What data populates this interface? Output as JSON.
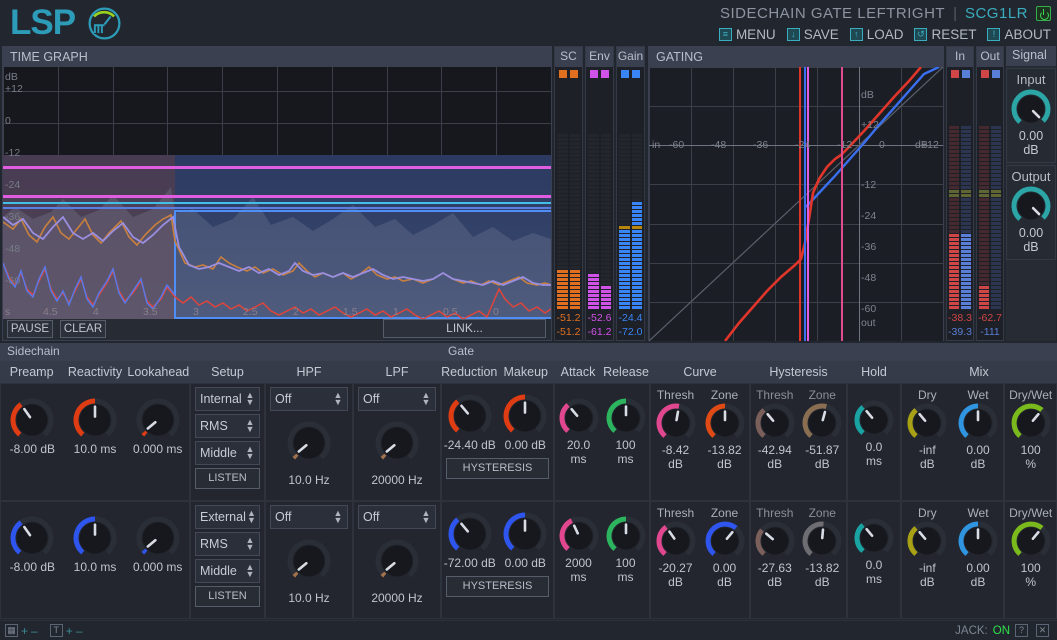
{
  "header": {
    "logo_text": "LSP",
    "plugin_title": "SIDECHAIN GATE LEFTRIGHT",
    "separator": "|",
    "plugin_id": "SCG1LR",
    "power_icon": "power-icon",
    "menu": [
      {
        "label": "MENU",
        "icon": "hamburger-icon",
        "glyph": "≡"
      },
      {
        "label": "SAVE",
        "icon": "download-icon",
        "glyph": "↓"
      },
      {
        "label": "LOAD",
        "icon": "upload-icon",
        "glyph": "↑"
      },
      {
        "label": "RESET",
        "icon": "refresh-icon",
        "glyph": "↺"
      },
      {
        "label": "ABOUT",
        "icon": "info-icon",
        "glyph": "!"
      }
    ]
  },
  "time_graph": {
    "title": "TIME GRAPH",
    "y_unit": "dB",
    "y_ticks": [
      "+12",
      "0",
      "-12",
      "-24",
      "-36",
      "-48",
      "-60"
    ],
    "x_unit": "s",
    "x_ticks": [
      "4.5",
      "4",
      "3.5",
      "3",
      "2.5",
      "2",
      "1.5",
      "1",
      "0.5",
      "0"
    ],
    "buttons": {
      "pause": "PAUSE",
      "clear": "CLEAR",
      "link": "LINK..."
    }
  },
  "sc_meters": [
    {
      "name": "SC",
      "color": "#e07020",
      "leds": 2,
      "values": [
        "-51.2",
        "-51.2"
      ],
      "fill": [
        0.205,
        0.205
      ]
    },
    {
      "name": "Env",
      "color": "#d152e8",
      "leds": 2,
      "values": [
        "-52.6",
        "-61.2"
      ],
      "fill": [
        0.2,
        0.125
      ]
    },
    {
      "name": "Gain",
      "color": "#3a85f5",
      "leds": 2,
      "values": [
        "-24.4",
        "-72.0"
      ],
      "fill": [
        0.455,
        0.6
      ]
    }
  ],
  "gating": {
    "title": "GATING",
    "in_label": "in",
    "out_label": "out",
    "db_label": "dB",
    "x_ticks": [
      "-60",
      "-48",
      "-36",
      "-24",
      "-12",
      "0",
      "+12"
    ],
    "y_ticks": [
      "+12",
      "-12",
      "-24",
      "-36",
      "-48",
      "-60"
    ]
  },
  "io_meters": [
    {
      "name": "In",
      "values": [
        "-38.3",
        "-39.3"
      ],
      "colors": [
        "#d04545",
        "#5a7fd8"
      ],
      "fill": [
        0.4,
        0.4
      ]
    },
    {
      "name": "Out",
      "values": [
        "-62.7",
        "-111"
      ],
      "colors": [
        "#d04545",
        "#5a7fd8"
      ],
      "fill": [
        0.13,
        0.0
      ]
    }
  ],
  "signal": {
    "title": "Signal",
    "input": {
      "label": "Input",
      "value": "0.00",
      "unit": "dB",
      "angle": 135,
      "color": "#2ba5a5"
    },
    "output": {
      "label": "Output",
      "value": "0.00",
      "unit": "dB",
      "angle": 135,
      "color": "#2ba5a5"
    }
  },
  "sidechain": {
    "title": "Sidechain",
    "columns": [
      "Preamp",
      "Reactivity",
      "Lookahead"
    ],
    "setup_header": "Setup",
    "hpf_header": "HPF",
    "lpf_header": "LPF",
    "rows": [
      {
        "knob_color": "#e03c14",
        "knobs": [
          {
            "name": "preamp",
            "value": "-8.00 dB",
            "angle": -35
          },
          {
            "name": "reactivity",
            "value": "10.0 ms",
            "angle": 0
          },
          {
            "name": "lookahead",
            "value": "0.000 ms",
            "angle": -130
          }
        ],
        "setup": {
          "source": "Internal",
          "mode": "RMS",
          "channel": "Middle",
          "listen": "LISTEN"
        },
        "hpf": {
          "mode": "Off",
          "value": "10.0 Hz",
          "angle": -130,
          "color": "#a0714a"
        },
        "lpf": {
          "mode": "Off",
          "value": "20000 Hz",
          "angle": -130,
          "color": "#a0714a"
        }
      },
      {
        "knob_color": "#2f55ef",
        "knobs": [
          {
            "name": "preamp",
            "value": "-8.00 dB",
            "angle": -35
          },
          {
            "name": "reactivity",
            "value": "10.0 ms",
            "angle": 0
          },
          {
            "name": "lookahead",
            "value": "0.000 ms",
            "angle": -130
          }
        ],
        "setup": {
          "source": "External",
          "mode": "RMS",
          "channel": "Middle",
          "listen": "LISTEN"
        },
        "hpf": {
          "mode": "Off",
          "value": "10.0 Hz",
          "angle": -130,
          "color": "#a0714a"
        },
        "lpf": {
          "mode": "Off",
          "value": "20000 Hz",
          "angle": -130,
          "color": "#a0714a"
        }
      }
    ]
  },
  "gate": {
    "title": "Gate",
    "headers": {
      "reduction": "Reduction",
      "makeup": "Makeup",
      "attack": "Attack",
      "release": "Release",
      "curve": "Curve",
      "hysteresis": "Hysteresis",
      "hold": "Hold",
      "mix": "Mix"
    },
    "sub_labels": {
      "thresh": "Thresh",
      "zone": "Zone",
      "dry": "Dry",
      "wet": "Wet",
      "drywet": "Dry/Wet"
    },
    "hysteresis_button": "HYSTERESIS",
    "rows": [
      {
        "reduction": {
          "value": "-24.40 dB",
          "angle": -40,
          "color": "#e03c14"
        },
        "makeup": {
          "value": "0.00 dB",
          "angle": 0,
          "color": "#e03c14",
          "pointer_up": true
        },
        "attack": {
          "value": "20.0",
          "unit": "ms",
          "angle": -40,
          "color": "#e0478f"
        },
        "release": {
          "value": "100",
          "unit": "ms",
          "angle": 0,
          "color": "#2cb45e"
        },
        "curve_thresh": {
          "value": "-8.42",
          "unit": "dB",
          "angle": 10,
          "color": "#e0478f"
        },
        "curve_zone": {
          "value": "-13.82",
          "unit": "dB",
          "angle": 0,
          "color": "#e04a14"
        },
        "hyst_thresh": {
          "value": "-42.94",
          "unit": "dB",
          "angle": -40,
          "color": "#7a5f5a"
        },
        "hyst_zone": {
          "value": "-51.87",
          "unit": "dB",
          "angle": 15,
          "color": "#8a6e52"
        },
        "hold": {
          "value": "0.0",
          "unit": "ms",
          "angle": -40,
          "color": "#19a3a3"
        },
        "dry": {
          "value": "-inf",
          "unit": "dB",
          "angle": -40,
          "color": "#a8a015"
        },
        "wet": {
          "value": "0.00",
          "unit": "dB",
          "angle": 0,
          "color": "#2f95e0"
        },
        "drywet": {
          "value": "100",
          "unit": "%",
          "angle": 40,
          "color": "#7aba1c"
        }
      },
      {
        "reduction": {
          "value": "-72.00 dB",
          "angle": -40,
          "color": "#2f55ef"
        },
        "makeup": {
          "value": "0.00 dB",
          "angle": 0,
          "color": "#2f55ef",
          "pointer_up": true
        },
        "attack": {
          "value": "2000",
          "unit": "ms",
          "angle": -25,
          "color": "#e0478f"
        },
        "release": {
          "value": "100",
          "unit": "ms",
          "angle": 0,
          "color": "#2cb45e"
        },
        "curve_thresh": {
          "value": "-20.27",
          "unit": "dB",
          "angle": -35,
          "color": "#e0478f"
        },
        "curve_zone": {
          "value": "0.00",
          "unit": "dB",
          "angle": 40,
          "color": "#2f55ef"
        },
        "hyst_thresh": {
          "value": "-27.63",
          "unit": "dB",
          "angle": -50,
          "color": "#7a5f5a"
        },
        "hyst_zone": {
          "value": "-13.82",
          "unit": "dB",
          "angle": 5,
          "color": "#6e6e72"
        },
        "hold": {
          "value": "0.0",
          "unit": "ms",
          "angle": -40,
          "color": "#19a3a3"
        },
        "dry": {
          "value": "-inf",
          "unit": "dB",
          "angle": -40,
          "color": "#a8a015"
        },
        "wet": {
          "value": "0.00",
          "unit": "dB",
          "angle": 0,
          "color": "#2f95e0"
        },
        "drywet": {
          "value": "100",
          "unit": "%",
          "angle": 40,
          "color": "#7aba1c"
        }
      }
    ]
  },
  "status_bar": {
    "left_icons": [
      "window-icon",
      "text-icon"
    ],
    "plus": "+",
    "minus": "–",
    "jack_label": "JACK:",
    "jack_value": "ON",
    "help_icon": "?",
    "close_icon": "✕"
  }
}
